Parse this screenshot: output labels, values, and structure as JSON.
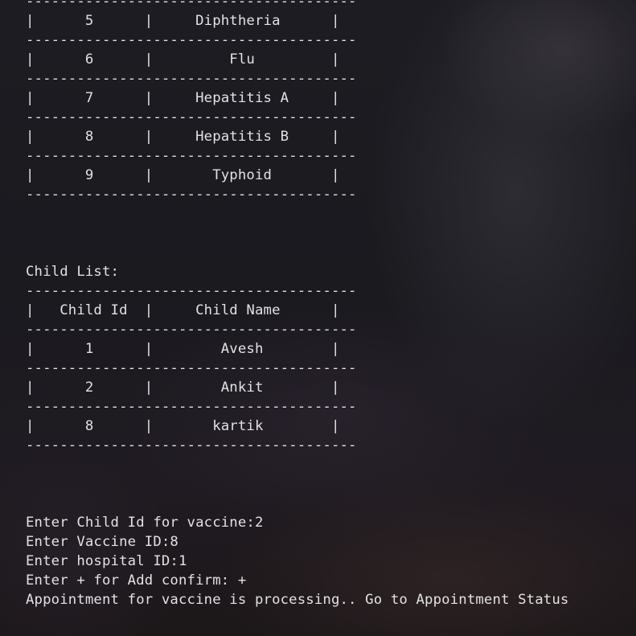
{
  "terminal": {
    "sep": "---------------------------------------",
    "vaccine_rows": [
      "|      5      |     Diphtheria      |",
      "|      6      |         Flu         |",
      "|      7      |     Hepatitis A     |",
      "|      8      |     Hepatitis B     |",
      "|      9      |       Typhoid       |"
    ],
    "child_list_label": "Child List:",
    "child_header": "|   Child Id  |     Child Name      |",
    "child_rows": [
      "|      1      |        Avesh        |",
      "|      2      |        Ankit        |",
      "|      8      |       kartik        |"
    ],
    "prompts": [
      "Enter Child Id for vaccine:2",
      "Enter Vaccine ID:8",
      "Enter hospital ID:1",
      "Enter + for Add confirm: +",
      "Appointment for vaccine is processing.. Go to Appointment Status"
    ]
  }
}
